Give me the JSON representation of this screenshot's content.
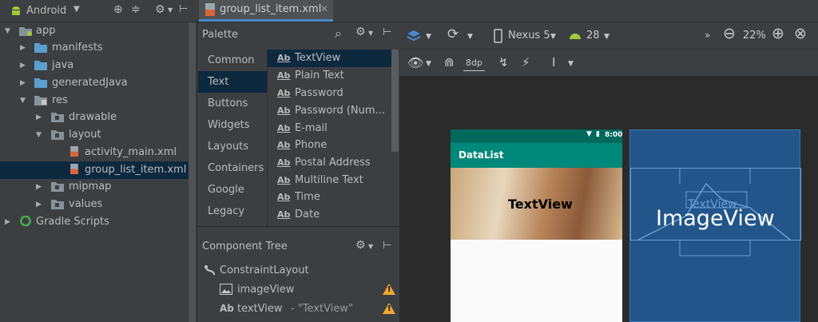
{
  "project": {
    "view_mode": "Android",
    "tree": [
      {
        "label": "app",
        "icon": "app-folder-icon",
        "expanded": true
      },
      {
        "label": "manifests",
        "icon": "folder-icon",
        "expanded": false
      },
      {
        "label": "java",
        "icon": "folder-icon",
        "expanded": false
      },
      {
        "label": "generatedJava",
        "icon": "folder-icon",
        "expanded": false
      },
      {
        "label": "res",
        "icon": "res-folder-icon",
        "expanded": true
      },
      {
        "label": "drawable",
        "icon": "folder-icon",
        "expanded": false
      },
      {
        "label": "layout",
        "icon": "folder-icon",
        "expanded": true
      },
      {
        "label": "activity_main.xml",
        "icon": "xml-layout-icon"
      },
      {
        "label": "group_list_item.xml",
        "icon": "xml-layout-icon",
        "selected": true
      },
      {
        "label": "mipmap",
        "icon": "folder-icon",
        "expanded": false
      },
      {
        "label": "values",
        "icon": "folder-icon",
        "expanded": false
      },
      {
        "label": "Gradle Scripts",
        "icon": "gradle-icon",
        "expanded": false
      }
    ]
  },
  "editor": {
    "tab_label": "group_list_item.xml",
    "device": "Nexus 5",
    "api_level": "28",
    "zoom": "22%",
    "margin": "8dp"
  },
  "palette": {
    "title": "Palette",
    "categories": [
      "Common",
      "Text",
      "Buttons",
      "Widgets",
      "Layouts",
      "Containers",
      "Google",
      "Legacy"
    ],
    "selected_category": "Text",
    "widgets": [
      "TextView",
      "Plain Text",
      "Password",
      "Password (Num...",
      "E-mail",
      "Phone",
      "Postal Address",
      "Multiline Text",
      "Time",
      "Date"
    ],
    "selected_widget": "TextView"
  },
  "component_tree": {
    "title": "Component Tree",
    "root": "ConstraintLayout",
    "children": [
      {
        "label": "imageView",
        "icon": "image-icon",
        "warning": true
      },
      {
        "label": "textView",
        "suffix": "- \"TextView\"",
        "icon": "text-icon",
        "warning": true
      }
    ]
  },
  "design": {
    "status_time": "8:00",
    "app_title": "DataList",
    "text_view_label": "TextView",
    "blueprint_image_label": "ImageView",
    "blueprint_text_label": "TextView"
  },
  "colors": {
    "accent": "#4a88c7",
    "warning": "#f0a732",
    "app_bar": "#00897b",
    "status_bar": "#00695c",
    "blueprint": "#22568a"
  }
}
